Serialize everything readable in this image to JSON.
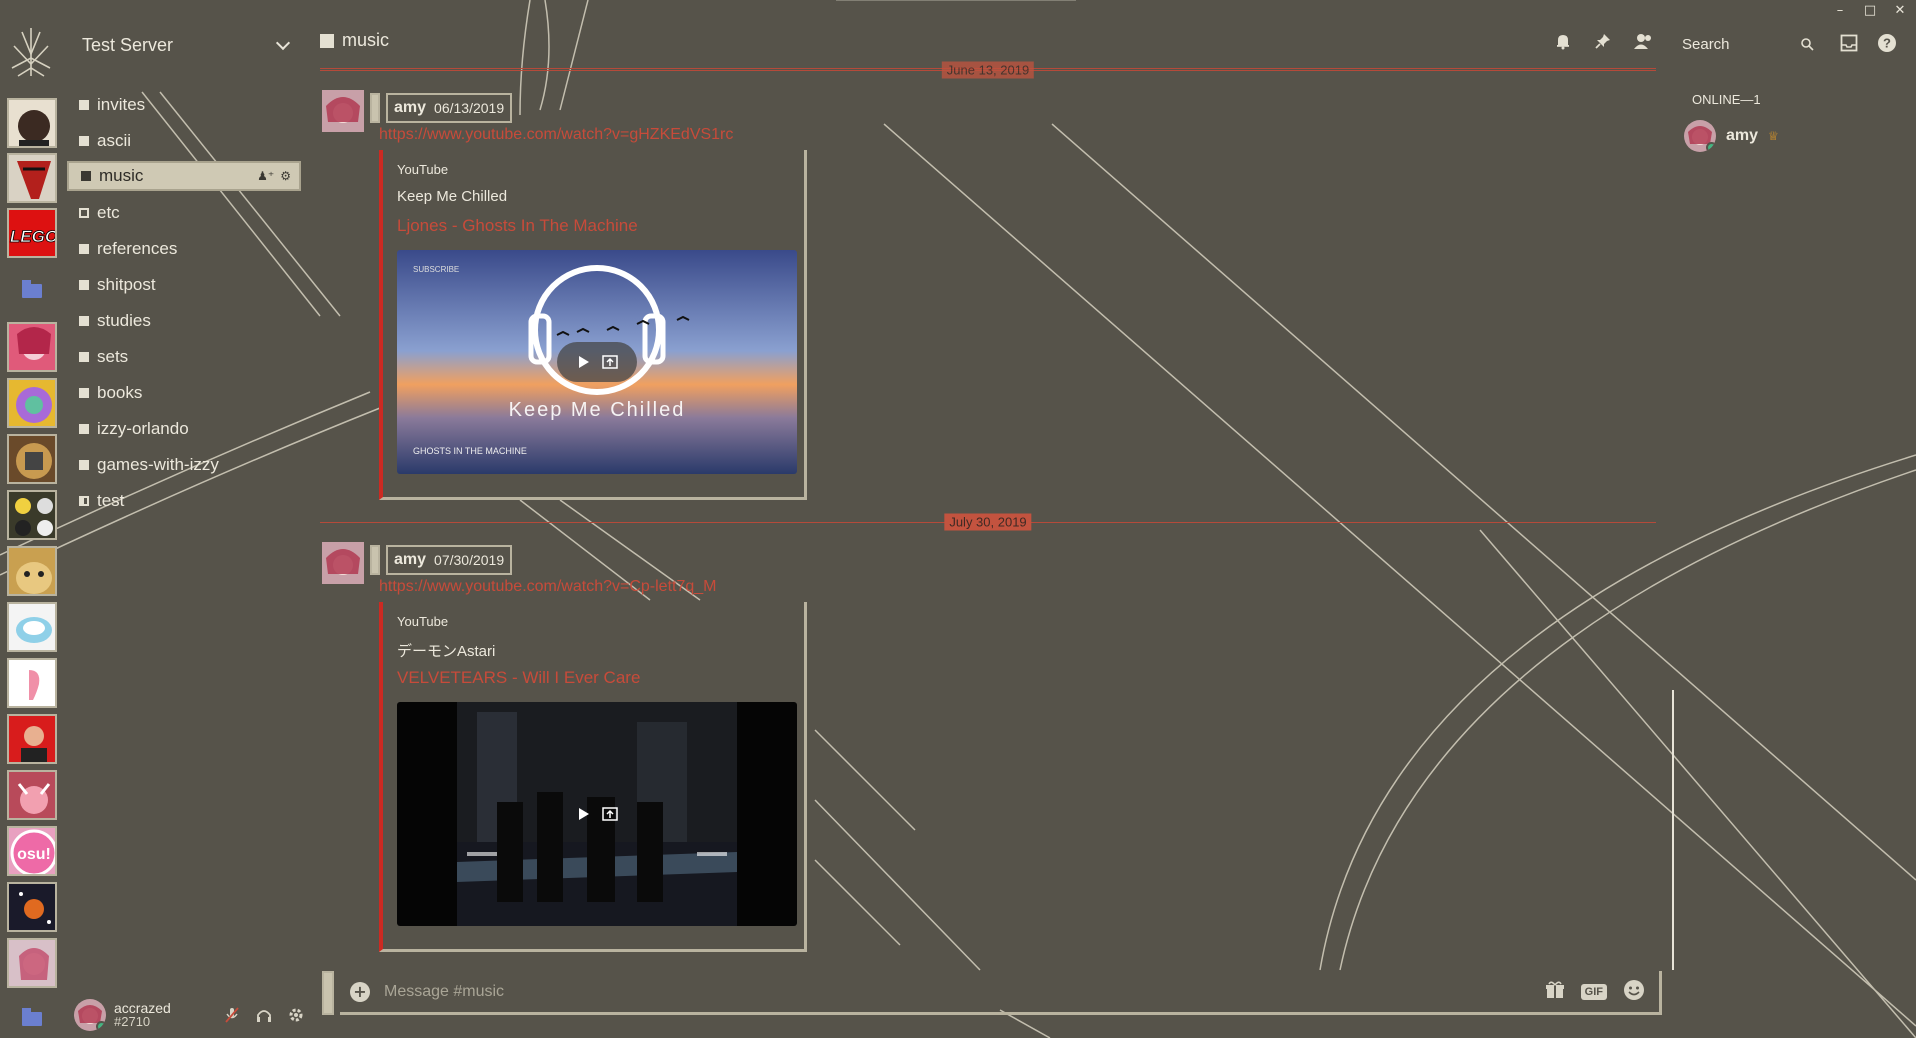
{
  "window": {
    "controls": [
      "minimize",
      "maximize",
      "close"
    ]
  },
  "server": {
    "name": "Test Server"
  },
  "servers": [
    {
      "name": "server-1",
      "type": "avatar"
    },
    {
      "name": "server-2",
      "type": "avatar"
    },
    {
      "name": "server-lego",
      "type": "avatar",
      "label": "LEGO"
    },
    {
      "name": "folder-1",
      "type": "folder"
    },
    {
      "name": "server-4",
      "type": "avatar"
    },
    {
      "name": "server-5",
      "type": "avatar"
    },
    {
      "name": "server-6",
      "type": "avatar"
    },
    {
      "name": "server-7",
      "type": "avatar"
    },
    {
      "name": "server-8",
      "type": "avatar"
    },
    {
      "name": "server-9",
      "type": "avatar"
    },
    {
      "name": "server-10",
      "type": "avatar"
    },
    {
      "name": "server-11",
      "type": "avatar"
    },
    {
      "name": "server-12",
      "type": "avatar"
    },
    {
      "name": "server-osu",
      "type": "avatar",
      "label": "osu!"
    },
    {
      "name": "server-14",
      "type": "avatar"
    },
    {
      "name": "server-15",
      "type": "avatar"
    },
    {
      "name": "folder-2",
      "type": "folder"
    }
  ],
  "channels": [
    {
      "label": "invites",
      "kind": "text"
    },
    {
      "label": "ascii",
      "kind": "text"
    },
    {
      "label": "music",
      "kind": "text",
      "active": true
    },
    {
      "label": "etc",
      "kind": "locked"
    },
    {
      "label": "references",
      "kind": "text"
    },
    {
      "label": "shitpost",
      "kind": "text"
    },
    {
      "label": "studies",
      "kind": "text"
    },
    {
      "label": "sets",
      "kind": "text"
    },
    {
      "label": "books",
      "kind": "text"
    },
    {
      "label": "izzy-orlando",
      "kind": "text"
    },
    {
      "label": "games-with-izzy",
      "kind": "text"
    },
    {
      "label": "test",
      "kind": "voice"
    }
  ],
  "chat": {
    "channel_title": "music",
    "search_placeholder": "Search",
    "composer_placeholder": "Message #music",
    "gif_label": "GIF"
  },
  "date_dividers": [
    {
      "label": "June 13, 2019"
    },
    {
      "label": "July 30, 2019"
    }
  ],
  "messages": [
    {
      "author": "amy",
      "timestamp": "06/13/2019",
      "link": "https://www.youtube.com/watch?v=gHZKEdVS1rc",
      "embed": {
        "provider": "YouTube",
        "author": "Keep Me Chilled",
        "title": "Ljones - Ghosts In The Machine",
        "thumb_caption": "Keep Me Chilled",
        "thumb_sub": "GHOSTS IN THE MACHINE",
        "thumb_corner": "SUBSCRIBE"
      }
    },
    {
      "author": "amy",
      "timestamp": "07/30/2019",
      "link": "https://www.youtube.com/watch?v=Cp-lett7q_M",
      "embed": {
        "provider": "YouTube",
        "author": "デーモンAstari",
        "title": "VELVETEARS - Will I Ever Care"
      }
    }
  ],
  "members": {
    "header": "ONLINE—1",
    "list": [
      {
        "name": "amy",
        "status": "online",
        "crown": true
      }
    ]
  },
  "user": {
    "name": "accrazed",
    "tag": "#2710",
    "status": "online"
  },
  "colors": {
    "background": "#56534a",
    "accent_red": "#c74b3a",
    "embed_bar": "#cc2a22",
    "active_channel": "#cfc9b4",
    "online": "#43b581"
  },
  "icons": {
    "header": [
      "bell-icon",
      "pin-icon",
      "members-icon",
      "search-icon",
      "inbox-icon",
      "help-icon"
    ],
    "user_controls": [
      "mic-muted-icon",
      "headphones-icon",
      "settings-icon"
    ],
    "composer": [
      "gift-icon",
      "gif-icon",
      "emoji-icon"
    ]
  }
}
